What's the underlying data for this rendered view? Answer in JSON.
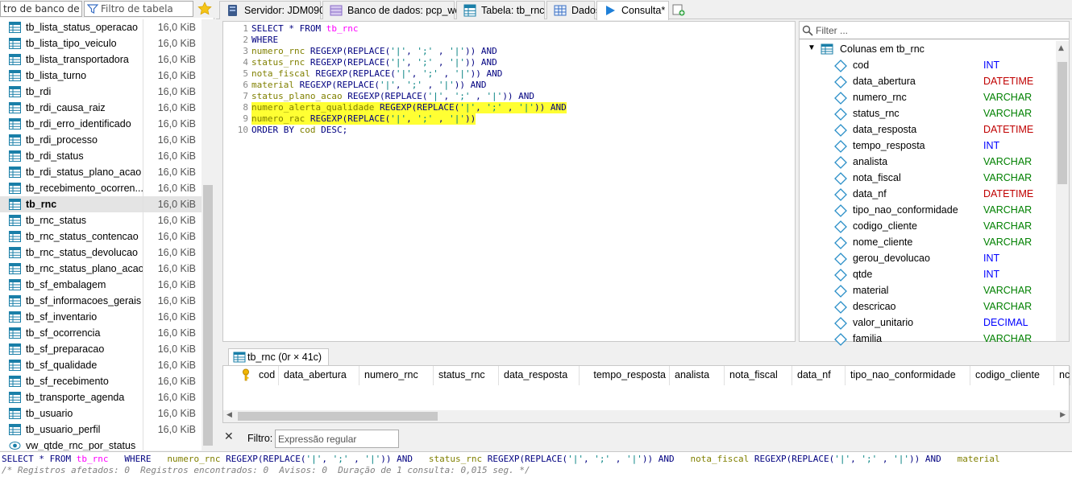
{
  "left_panel": {
    "db_filter_value": "tro de banco de dad",
    "table_filter_placeholder": "Filtro de tabela",
    "tables": [
      {
        "name": "tb_lista_status_operacao",
        "size": "16,0 KiB"
      },
      {
        "name": "tb_lista_tipo_veiculo",
        "size": "16,0 KiB"
      },
      {
        "name": "tb_lista_transportadora",
        "size": "16,0 KiB"
      },
      {
        "name": "tb_lista_turno",
        "size": "16,0 KiB"
      },
      {
        "name": "tb_rdi",
        "size": "16,0 KiB"
      },
      {
        "name": "tb_rdi_causa_raiz",
        "size": "16,0 KiB"
      },
      {
        "name": "tb_rdi_erro_identificado",
        "size": "16,0 KiB"
      },
      {
        "name": "tb_rdi_processo",
        "size": "16,0 KiB"
      },
      {
        "name": "tb_rdi_status",
        "size": "16,0 KiB"
      },
      {
        "name": "tb_rdi_status_plano_acao",
        "size": "16,0 KiB"
      },
      {
        "name": "tb_recebimento_ocorren...",
        "size": "16,0 KiB"
      },
      {
        "name": "tb_rnc",
        "size": "16,0 KiB",
        "selected": true
      },
      {
        "name": "tb_rnc_status",
        "size": "16,0 KiB"
      },
      {
        "name": "tb_rnc_status_contencao",
        "size": "16,0 KiB"
      },
      {
        "name": "tb_rnc_status_devolucao",
        "size": "16,0 KiB"
      },
      {
        "name": "tb_rnc_status_plano_acao",
        "size": "16,0 KiB"
      },
      {
        "name": "tb_sf_embalagem",
        "size": "16,0 KiB"
      },
      {
        "name": "tb_sf_informacoes_gerais",
        "size": "16,0 KiB"
      },
      {
        "name": "tb_sf_inventario",
        "size": "16,0 KiB"
      },
      {
        "name": "tb_sf_ocorrencia",
        "size": "16,0 KiB"
      },
      {
        "name": "tb_sf_preparacao",
        "size": "16,0 KiB"
      },
      {
        "name": "tb_sf_qualidade",
        "size": "16,0 KiB"
      },
      {
        "name": "tb_sf_recebimento",
        "size": "16,0 KiB"
      },
      {
        "name": "tb_transporte_agenda",
        "size": "16,0 KiB"
      },
      {
        "name": "tb_usuario",
        "size": "16,0 KiB"
      },
      {
        "name": "tb_usuario_perfil",
        "size": "16,0 KiB"
      },
      {
        "name": "vw_qtde_rnc_por_status",
        "size": ""
      }
    ]
  },
  "tabs": [
    {
      "label": "Servidor: JDM090",
      "icon": "server-icon"
    },
    {
      "label": "Banco de dados: pcp_web",
      "icon": "database-icon"
    },
    {
      "label": "Tabela: tb_rnc",
      "icon": "table-icon"
    },
    {
      "label": "Dados",
      "icon": "grid-icon"
    },
    {
      "label": "Consulta*",
      "icon": "play-icon",
      "active": true
    }
  ],
  "editor": {
    "lines": [
      {
        "n": "1",
        "hl": false,
        "tokens": [
          [
            "kw",
            "SELECT * FROM "
          ],
          [
            "tbl",
            "tb_rnc"
          ]
        ]
      },
      {
        "n": "2",
        "hl": false,
        "tokens": [
          [
            "kw",
            "WHERE"
          ]
        ]
      },
      {
        "n": "3",
        "hl": false,
        "tokens": [
          [
            "col",
            "numero_rnc"
          ],
          [
            "kw",
            " REGEXP(REPLACE("
          ],
          [
            "str",
            "'|'"
          ],
          [
            "kw",
            ", "
          ],
          [
            "str",
            "';'"
          ],
          [
            "kw",
            " , "
          ],
          [
            "str",
            "'|'"
          ],
          [
            "kw",
            ")) AND"
          ]
        ]
      },
      {
        "n": "4",
        "hl": false,
        "tokens": [
          [
            "col",
            "status_rnc"
          ],
          [
            "kw",
            " REGEXP(REPLACE("
          ],
          [
            "str",
            "'|'"
          ],
          [
            "kw",
            ", "
          ],
          [
            "str",
            "';'"
          ],
          [
            "kw",
            " , "
          ],
          [
            "str",
            "'|'"
          ],
          [
            "kw",
            ")) AND"
          ]
        ]
      },
      {
        "n": "5",
        "hl": false,
        "tokens": [
          [
            "col",
            "nota_fiscal"
          ],
          [
            "kw",
            " REGEXP(REPLACE("
          ],
          [
            "str",
            "'|'"
          ],
          [
            "kw",
            ", "
          ],
          [
            "str",
            "';'"
          ],
          [
            "kw",
            " , "
          ],
          [
            "str",
            "'|'"
          ],
          [
            "kw",
            ")) AND"
          ]
        ]
      },
      {
        "n": "6",
        "hl": false,
        "tokens": [
          [
            "col",
            "material"
          ],
          [
            "kw",
            " REGEXP(REPLACE("
          ],
          [
            "str",
            "'|'"
          ],
          [
            "kw",
            ", "
          ],
          [
            "str",
            "';'"
          ],
          [
            "kw",
            " , "
          ],
          [
            "str",
            "'|'"
          ],
          [
            "kw",
            ")) AND"
          ]
        ]
      },
      {
        "n": "7",
        "hl": false,
        "tokens": [
          [
            "col",
            "status_plano_acao"
          ],
          [
            "kw",
            " REGEXP(REPLACE("
          ],
          [
            "str",
            "'|'"
          ],
          [
            "kw",
            ", "
          ],
          [
            "str",
            "';'"
          ],
          [
            "kw",
            " , "
          ],
          [
            "str",
            "'|'"
          ],
          [
            "kw",
            ")) AND"
          ]
        ]
      },
      {
        "n": "8",
        "hl": true,
        "tokens": [
          [
            "col",
            "numero_alerta_qualidade"
          ],
          [
            "kw",
            " REGEXP(REPLACE("
          ],
          [
            "str",
            "'|'"
          ],
          [
            "kw",
            ", "
          ],
          [
            "str",
            "';'"
          ],
          [
            "kw",
            " , "
          ],
          [
            "str",
            "'|'"
          ],
          [
            "kw",
            ")) AND"
          ]
        ]
      },
      {
        "n": "9",
        "hl": true,
        "tokens": [
          [
            "col",
            "numero_rac"
          ],
          [
            "kw",
            " REGEXP(REPLACE("
          ],
          [
            "str",
            "'|'"
          ],
          [
            "kw",
            ", "
          ],
          [
            "str",
            "';'"
          ],
          [
            "kw",
            " , "
          ],
          [
            "str",
            "'|'"
          ],
          [
            "kw",
            "))"
          ]
        ]
      },
      {
        "n": "10",
        "hl": false,
        "tokens": [
          [
            "kw",
            "ORDER BY "
          ],
          [
            "col",
            "cod"
          ],
          [
            "kw",
            " DESC;"
          ]
        ]
      }
    ]
  },
  "columns_panel": {
    "filter_placeholder": "Filter ...",
    "header": "Colunas em tb_rnc",
    "columns": [
      {
        "name": "cod",
        "type": "INT",
        "color": "#0000ff"
      },
      {
        "name": "data_abertura",
        "type": "DATETIME",
        "color": "#c00000"
      },
      {
        "name": "numero_rnc",
        "type": "VARCHAR",
        "color": "#008000"
      },
      {
        "name": "status_rnc",
        "type": "VARCHAR",
        "color": "#008000"
      },
      {
        "name": "data_resposta",
        "type": "DATETIME",
        "color": "#c00000"
      },
      {
        "name": "tempo_resposta",
        "type": "INT",
        "color": "#0000ff"
      },
      {
        "name": "analista",
        "type": "VARCHAR",
        "color": "#008000"
      },
      {
        "name": "nota_fiscal",
        "type": "VARCHAR",
        "color": "#008000"
      },
      {
        "name": "data_nf",
        "type": "DATETIME",
        "color": "#c00000"
      },
      {
        "name": "tipo_nao_conformidade",
        "type": "VARCHAR",
        "color": "#008000"
      },
      {
        "name": "codigo_cliente",
        "type": "VARCHAR",
        "color": "#008000"
      },
      {
        "name": "nome_cliente",
        "type": "VARCHAR",
        "color": "#008000"
      },
      {
        "name": "gerou_devolucao",
        "type": "INT",
        "color": "#0000ff"
      },
      {
        "name": "qtde",
        "type": "INT",
        "color": "#0000ff"
      },
      {
        "name": "material",
        "type": "VARCHAR",
        "color": "#008000"
      },
      {
        "name": "descricao",
        "type": "VARCHAR",
        "color": "#008000"
      },
      {
        "name": "valor_unitario",
        "type": "DECIMAL",
        "color": "#0000ff"
      },
      {
        "name": "familia",
        "type": "VARCHAR",
        "color": "#008000"
      }
    ]
  },
  "results": {
    "tab_label": "tb_rnc (0r × 41c)",
    "headers": [
      "cod",
      "data_abertura",
      "numero_rnc",
      "status_rnc",
      "data_resposta",
      "tempo_resposta",
      "analista",
      "nota_fiscal",
      "data_nf",
      "tipo_nao_conformidade",
      "codigo_cliente",
      "nc"
    ]
  },
  "filter_bar": {
    "label": "Filtro:",
    "placeholder": "Expressão regular"
  },
  "log": {
    "line1_tokens": [
      [
        "kw",
        "SELECT * FROM "
      ],
      [
        "tbl",
        "tb_rnc"
      ],
      [
        "kw",
        "   WHERE   "
      ],
      [
        "col",
        "numero_rnc"
      ],
      [
        "kw",
        " REGEXP(REPLACE("
      ],
      [
        "str",
        "'|'"
      ],
      [
        "kw",
        ", "
      ],
      [
        "str",
        "';'"
      ],
      [
        "kw",
        " , "
      ],
      [
        "str",
        "'|'"
      ],
      [
        "kw",
        ")) AND   "
      ],
      [
        "col",
        "status_rnc"
      ],
      [
        "kw",
        " REGEXP(REPLACE("
      ],
      [
        "str",
        "'|'"
      ],
      [
        "kw",
        ", "
      ],
      [
        "str",
        "';'"
      ],
      [
        "kw",
        " , "
      ],
      [
        "str",
        "'|'"
      ],
      [
        "kw",
        ")) AND   "
      ],
      [
        "col",
        "nota_fiscal"
      ],
      [
        "kw",
        " REGEXP(REPLACE("
      ],
      [
        "str",
        "'|'"
      ],
      [
        "kw",
        ", "
      ],
      [
        "str",
        "';'"
      ],
      [
        "kw",
        " , "
      ],
      [
        "str",
        "'|'"
      ],
      [
        "kw",
        ")) AND   "
      ],
      [
        "col",
        "material"
      ]
    ],
    "line2": "/* Registros afetados: 0  Registros encontrados: 0  Avisos: 0  Duração de 1 consulta: 0,015 seg. */"
  }
}
